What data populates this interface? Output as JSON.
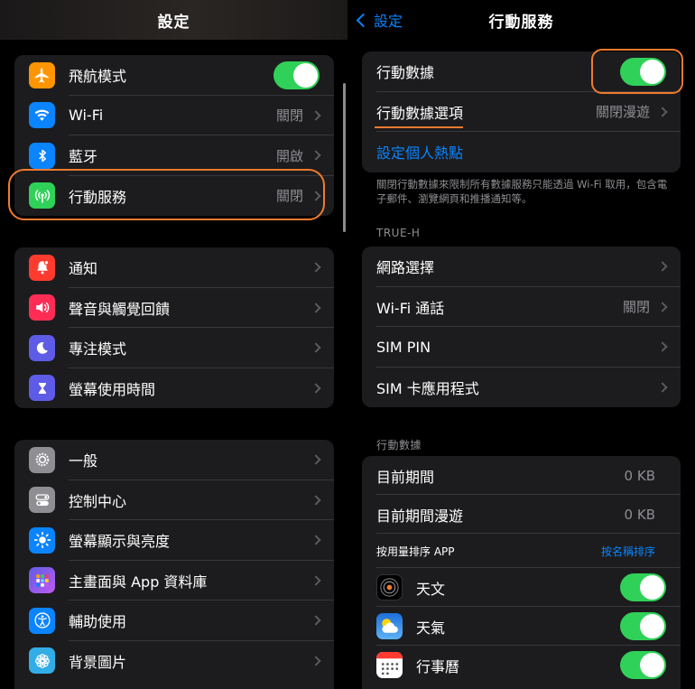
{
  "left": {
    "title": "設定",
    "group1": [
      {
        "label": "飛航模式",
        "icon": "airplane-icon",
        "color": "#ff9500",
        "toggle": true
      },
      {
        "label": "Wi-Fi",
        "icon": "wifi-icon",
        "color": "#0a84ff",
        "value": "關閉"
      },
      {
        "label": "藍牙",
        "icon": "bluetooth-icon",
        "color": "#0a84ff",
        "value": "開啟"
      },
      {
        "label": "行動服務",
        "icon": "antenna-icon",
        "color": "#30d158",
        "value": "關閉"
      }
    ],
    "group2": [
      {
        "label": "通知",
        "icon": "bell-icon",
        "color": "#ff3b30"
      },
      {
        "label": "聲音與觸覺回饋",
        "icon": "speaker-icon",
        "color": "#ff2d55"
      },
      {
        "label": "專注模式",
        "icon": "moon-icon",
        "color": "#5e5ce6"
      },
      {
        "label": "螢幕使用時間",
        "icon": "hourglass-icon",
        "color": "#5e5ce6"
      }
    ],
    "group3": [
      {
        "label": "一般",
        "icon": "gear-icon",
        "color": "#8e8e93"
      },
      {
        "label": "控制中心",
        "icon": "switches-icon",
        "color": "#8e8e93"
      },
      {
        "label": "螢幕顯示與亮度",
        "icon": "brightness-icon",
        "color": "#0a84ff"
      },
      {
        "label": "主畫面與 App 資料庫",
        "icon": "app-grid-icon",
        "color": "#5e5ce6"
      },
      {
        "label": "輔助使用",
        "icon": "accessibility-icon",
        "color": "#0a84ff"
      },
      {
        "label": "背景圖片",
        "icon": "flower-icon",
        "color": "#32ade6"
      }
    ]
  },
  "right": {
    "back_label": "設定",
    "title": "行動服務",
    "group1": {
      "cellular_data": "行動數據",
      "cellular_options": "行動數據選項",
      "cellular_options_value": "關閉漫遊",
      "hotspot": "設定個人熱點"
    },
    "footer": "關閉行動數據來限制所有數據服務只能透過 Wi-Fi 取用，包含電子郵件、瀏覽網頁和推播通知等。",
    "carrier_header": "TRUE-H",
    "group2": [
      {
        "label": "網路選擇",
        "value": ""
      },
      {
        "label": "Wi-Fi 通話",
        "value": "關閉"
      },
      {
        "label": "SIM PIN",
        "value": ""
      },
      {
        "label": "SIM 卡應用程式",
        "value": ""
      }
    ],
    "data_header": "行動數據",
    "usage": [
      {
        "label": "目前期間",
        "value": "0 KB"
      },
      {
        "label": "目前期間漫遊",
        "value": "0 KB"
      }
    ],
    "sort_label": "按用量排序 APP",
    "sort_link": "按名稱排序",
    "apps": [
      {
        "label": "天文",
        "icon": "astronomy-icon"
      },
      {
        "label": "天氣",
        "icon": "weather-icon"
      },
      {
        "label": "行事曆",
        "icon": "calendar-icon"
      }
    ]
  },
  "colors": {
    "accent": "#0a84ff",
    "toggle_on": "#30d158",
    "highlight": "#f07b2e"
  }
}
